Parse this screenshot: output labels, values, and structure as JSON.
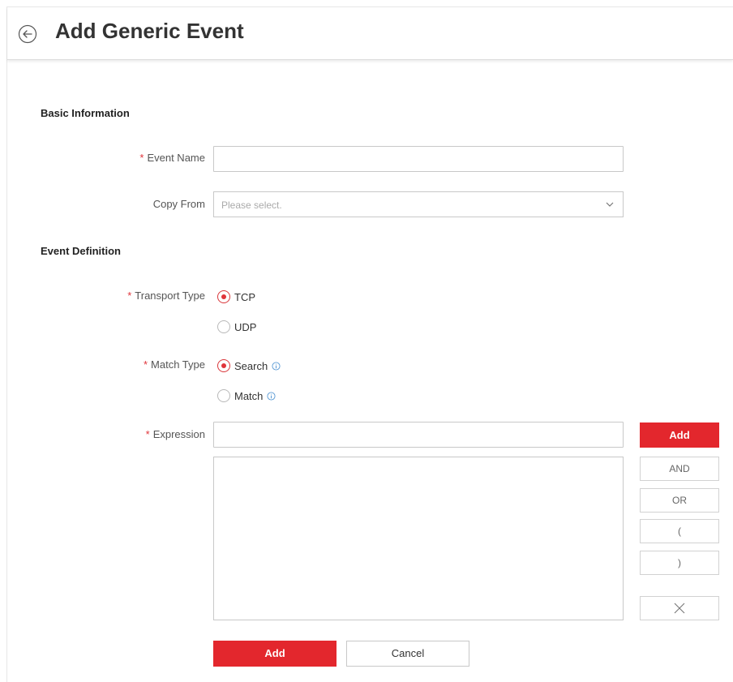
{
  "header": {
    "title": "Add Generic Event",
    "back_icon": "back-arrow-circle-icon"
  },
  "sections": {
    "basic": "Basic Information",
    "definition": "Event Definition"
  },
  "fields": {
    "event_name": {
      "label": "Event Name",
      "required": "*",
      "value": ""
    },
    "copy_from": {
      "label": "Copy From",
      "placeholder": "Please select."
    },
    "transport_type": {
      "label": "Transport Type",
      "required": "*",
      "options": [
        {
          "label": "TCP",
          "selected": true
        },
        {
          "label": "UDP",
          "selected": false
        }
      ]
    },
    "match_type": {
      "label": "Match Type",
      "required": "*",
      "options": [
        {
          "label": "Search",
          "selected": true
        },
        {
          "label": "Match",
          "selected": false
        }
      ]
    },
    "expression": {
      "label": "Expression",
      "required": "*",
      "value": ""
    }
  },
  "expression_buttons": {
    "add": "Add",
    "and": "AND",
    "or": "OR",
    "open_paren": "(",
    "close_paren": ")",
    "clear_icon": "close-x-icon"
  },
  "footer": {
    "add": "Add",
    "cancel": "Cancel"
  },
  "colors": {
    "accent": "#e3272d",
    "info": "#5b9bd5"
  }
}
